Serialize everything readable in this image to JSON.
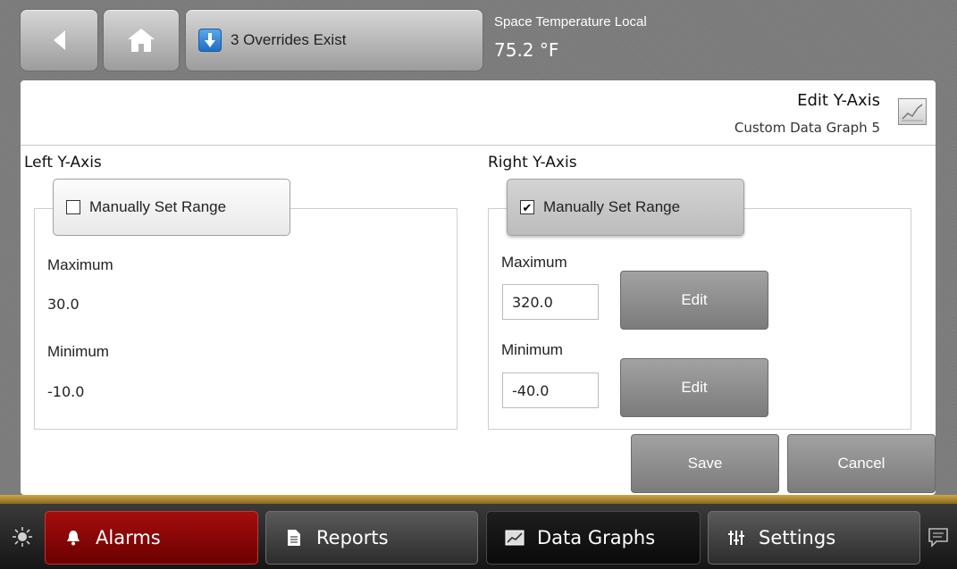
{
  "topbar": {
    "overrides_label": "3 Overrides Exist",
    "temp_title": "Space Temperature Local",
    "temp_value": "75.2 °F"
  },
  "header": {
    "title": "Edit Y-Axis",
    "subtitle": "Custom Data Graph 5"
  },
  "left_axis": {
    "title": "Left Y-Axis",
    "manual_label": "Manually Set Range",
    "manual_checked": false,
    "max_label": "Maximum",
    "max_value": "30.0",
    "min_label": "Minimum",
    "min_value": "-10.0"
  },
  "right_axis": {
    "title": "Right Y-Axis",
    "manual_label": "Manually Set Range",
    "manual_checked": true,
    "max_label": "Maximum",
    "max_value": "320.0",
    "min_label": "Minimum",
    "min_value": "-40.0",
    "edit_label": "Edit"
  },
  "actions": {
    "save": "Save",
    "cancel": "Cancel"
  },
  "nav": {
    "alarms": "Alarms",
    "reports": "Reports",
    "data_graphs": "Data Graphs",
    "settings": "Settings"
  },
  "icons": [
    "back-arrow-icon",
    "home-icon",
    "override-down-arrow-icon",
    "graph-icon",
    "brightness-icon",
    "bell-icon",
    "document-icon",
    "chart-icon",
    "sliders-icon",
    "chat-icon"
  ],
  "colors": {
    "alarm_tab": "#a60d0d",
    "accent_strip": "#cfa64a",
    "override_icon": "#2f80d4"
  }
}
